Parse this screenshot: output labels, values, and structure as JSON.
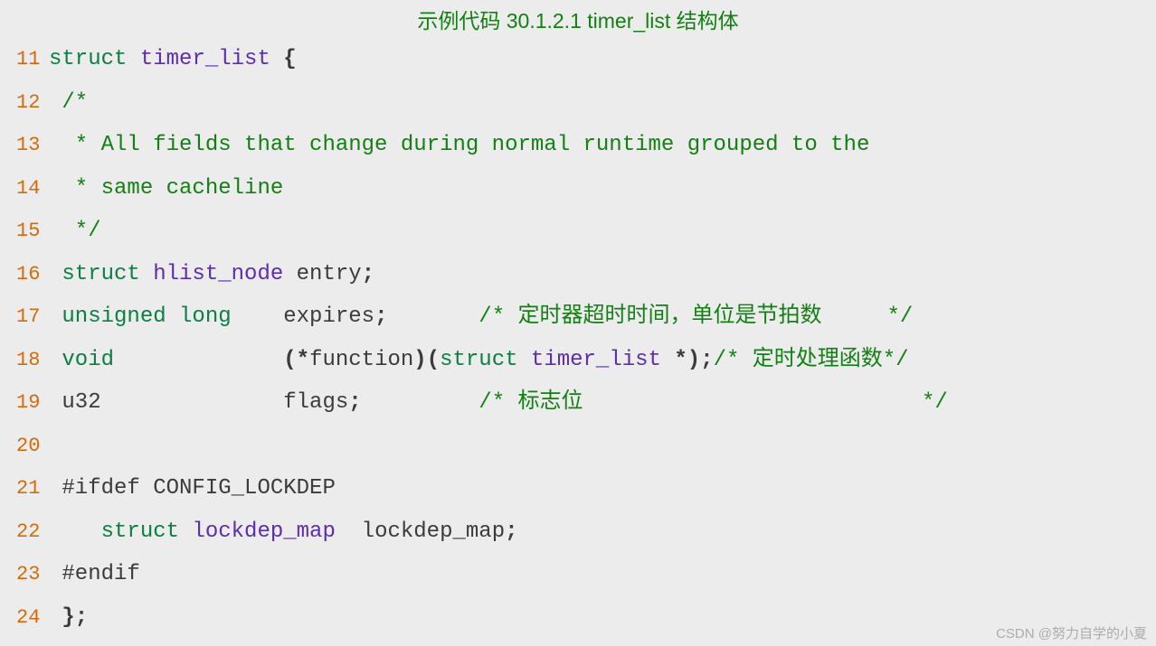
{
  "title": "示例代码 30.1.2.1 timer_list 结构体",
  "watermark": "CSDN @努力自学的小夏",
  "lines": [
    {
      "n": "11",
      "t": [
        [
          "kw",
          "struct "
        ],
        [
          "id",
          "timer_list "
        ],
        [
          "op",
          "{"
        ]
      ]
    },
    {
      "n": "12",
      "t": [
        [
          "cm",
          " /*"
        ]
      ]
    },
    {
      "n": "13",
      "t": [
        [
          "cm",
          "  * All fields that change during normal runtime grouped to the"
        ]
      ]
    },
    {
      "n": "14",
      "t": [
        [
          "cm",
          "  * same cacheline"
        ]
      ]
    },
    {
      "n": "15",
      "t": [
        [
          "cm",
          "  */"
        ]
      ]
    },
    {
      "n": "16",
      "t": [
        [
          "kw",
          " struct "
        ],
        [
          "id",
          "hlist_node "
        ],
        [
          "pl",
          "entry"
        ],
        [
          "op",
          ";"
        ]
      ]
    },
    {
      "n": "17",
      "t": [
        [
          "kw",
          " unsigned long    "
        ],
        [
          "pl",
          "expires"
        ],
        [
          "op",
          ";       "
        ],
        [
          "cm",
          "/* 定时器超时时间，单位是节拍数     */"
        ]
      ]
    },
    {
      "n": "18",
      "t": [
        [
          "kw",
          " void             "
        ],
        [
          "op",
          "(*"
        ],
        [
          "pl",
          "function"
        ],
        [
          "op",
          ")("
        ],
        [
          "kw",
          "struct "
        ],
        [
          "id",
          "timer_list "
        ],
        [
          "op",
          "*);"
        ],
        [
          "cm",
          "/* 定时处理函数*/"
        ]
      ]
    },
    {
      "n": "19",
      "t": [
        [
          "pl",
          " u32              flags"
        ],
        [
          "op",
          ";         "
        ],
        [
          "cm",
          "/* 标志位                          */"
        ]
      ]
    },
    {
      "n": "20",
      "t": [
        [
          "pl",
          ""
        ]
      ]
    },
    {
      "n": "21",
      "t": [
        [
          "pp",
          " #ifdef CONFIG_LOCKDEP"
        ]
      ]
    },
    {
      "n": "22",
      "t": [
        [
          "kw",
          "    struct "
        ],
        [
          "id",
          "lockdep_map  "
        ],
        [
          "pl",
          "lockdep_map"
        ],
        [
          "op",
          ";"
        ]
      ]
    },
    {
      "n": "23",
      "t": [
        [
          "pp",
          " #endif"
        ]
      ]
    },
    {
      "n": "24",
      "t": [
        [
          "op",
          " };"
        ]
      ]
    }
  ]
}
